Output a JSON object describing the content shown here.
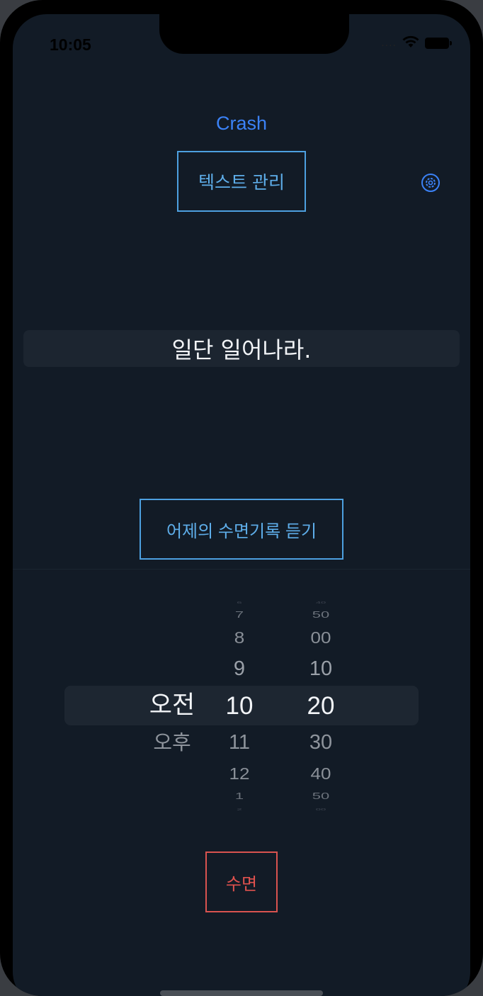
{
  "status_bar": {
    "time": "10:05",
    "signal": "....",
    "icons": [
      "wifi-icon",
      "battery-icon"
    ]
  },
  "header": {
    "crash_label": "Crash",
    "text_manage_label": "텍스트 관리",
    "settings_icon": "gear-circle-icon"
  },
  "quote": {
    "text": "일단 일어나라."
  },
  "sleep_record_label": "어제의 수면기록 듣기",
  "picker": {
    "ampm": {
      "items": [
        "오전",
        "오후"
      ],
      "selected": "오전"
    },
    "hours": {
      "items": [
        "6",
        "7",
        "8",
        "9",
        "10",
        "11",
        "12",
        "1",
        "2"
      ],
      "selected": "10"
    },
    "minutes": {
      "items": [
        "40",
        "50",
        "00",
        "10",
        "20",
        "30",
        "40",
        "50",
        "00"
      ],
      "selected": "20"
    }
  },
  "sleep_button_label": "수면",
  "colors": {
    "background": "#121b26",
    "accent_blue": "#3b82f6",
    "outline_blue": "#4da0e0",
    "sleep_red": "#e0524e"
  }
}
